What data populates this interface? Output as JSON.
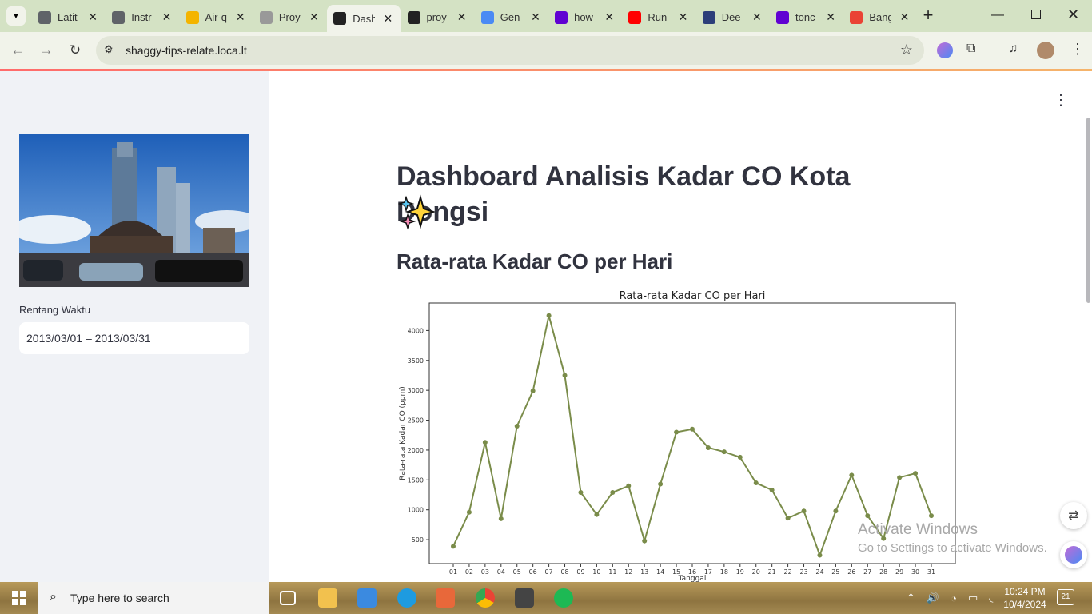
{
  "browser": {
    "tabs": [
      {
        "title": "Latit",
        "color": "#5f6368"
      },
      {
        "title": "Instr",
        "color": "#5f6368"
      },
      {
        "title": "Air-q",
        "color": "#f4b400"
      },
      {
        "title": "Proy",
        "color": "#999999"
      },
      {
        "title": "Dash",
        "color": "#222222"
      },
      {
        "title": "proy",
        "color": "#222222"
      },
      {
        "title": "Gen",
        "color": "#4a8af4"
      },
      {
        "title": "how",
        "color": "#6001d2"
      },
      {
        "title": "Run",
        "color": "#ff0000"
      },
      {
        "title": "Dee",
        "color": "#2c3e7a"
      },
      {
        "title": "tonc",
        "color": "#6001d2"
      },
      {
        "title": "Bang",
        "color": "#ea4335"
      }
    ],
    "active_tab": 4,
    "url": "shaggy-tips-relate.loca.lt"
  },
  "sidebar": {
    "date_label": "Rentang Waktu",
    "date_range": "2013/03/01 – 2013/03/31"
  },
  "main": {
    "title": "Dashboard Analisis Kadar CO Kota Dongsi",
    "subtitle": "Rata-rata Kadar CO per Hari"
  },
  "chart_data": {
    "type": "line",
    "title": "Rata-rata Kadar CO per Hari",
    "xlabel": "Tanggal",
    "ylabel": "Rata-rata Kadar CO (ppm)",
    "categories": [
      "01",
      "02",
      "03",
      "04",
      "05",
      "06",
      "07",
      "08",
      "09",
      "10",
      "11",
      "12",
      "13",
      "14",
      "15",
      "16",
      "17",
      "18",
      "19",
      "20",
      "21",
      "22",
      "23",
      "24",
      "25",
      "26",
      "27",
      "28",
      "29",
      "30",
      "31"
    ],
    "values": [
      390,
      960,
      2130,
      850,
      2400,
      2990,
      4250,
      3250,
      1290,
      920,
      1290,
      1400,
      480,
      1430,
      2300,
      2350,
      2040,
      1970,
      1880,
      1450,
      1330,
      860,
      980,
      240,
      980,
      1580,
      900,
      520,
      1540,
      1610,
      900
    ],
    "yticks": [
      500,
      1000,
      1500,
      2000,
      2500,
      3000,
      3500,
      4000
    ],
    "ylim": [
      100,
      4460
    ],
    "color": "#7a8c4a",
    "grid": false
  },
  "watermark": {
    "line1": "Activate Windows",
    "line2": "Go to Settings to activate Windows."
  },
  "taskbar": {
    "search_placeholder": "Type here to search",
    "time": "10:24 PM",
    "date": "10/4/2024",
    "notification_count": "21"
  }
}
